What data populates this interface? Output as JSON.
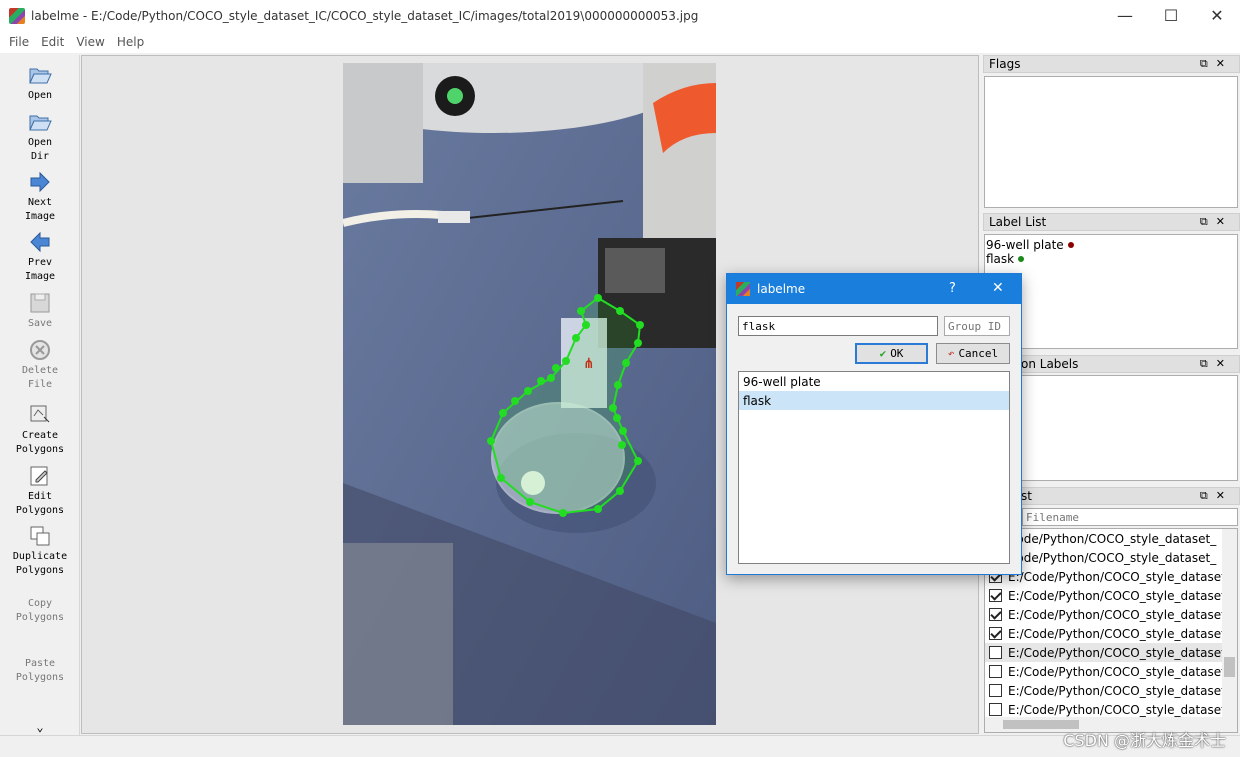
{
  "window": {
    "title": "labelme - E:/Code/Python/COCO_style_dataset_IC/COCO_style_dataset_IC/images/total2019\\000000000053.jpg",
    "controls": [
      "—",
      "☐",
      "✕"
    ]
  },
  "menu": [
    "File",
    "Edit",
    "View",
    "Help"
  ],
  "toolbar": {
    "open": "Open",
    "open_dir_1": "Open",
    "open_dir_2": "Dir",
    "next_1": "Next",
    "next_2": "Image",
    "prev_1": "Prev",
    "prev_2": "Image",
    "save": "Save",
    "delete_1": "Delete",
    "delete_2": "File",
    "create_1": "Create",
    "create_2": "Polygons",
    "edit_1": "Edit",
    "edit_2": "Polygons",
    "duplicate_1": "Duplicate",
    "duplicate_2": "Polygons",
    "copy_1": "Copy",
    "copy_2": "Polygons",
    "paste_1": "Paste",
    "paste_2": "Polygons",
    "more": "⌄"
  },
  "docks": {
    "flags": {
      "title": "Flags"
    },
    "label_list": {
      "title": "Label List",
      "items": [
        {
          "label": "96-well plate",
          "color": "#8b0000"
        },
        {
          "label": "flask",
          "color": "#1b8a1b"
        }
      ]
    },
    "polygon_labels": {
      "title": "on Labels"
    },
    "file_list": {
      "title": "st",
      "search_placeholder": "Filename",
      "rows": [
        {
          "path": "Code/Python/COCO_style_dataset_",
          "checked": true
        },
        {
          "path": "Code/Python/COCO_style_dataset_",
          "checked": true
        },
        {
          "path": "E:/Code/Python/COCO_style_dataset_",
          "checked": true
        },
        {
          "path": "E:/Code/Python/COCO_style_dataset_",
          "checked": true
        },
        {
          "path": "E:/Code/Python/COCO_style_dataset_",
          "checked": true
        },
        {
          "path": "E:/Code/Python/COCO_style_dataset_",
          "checked": true
        },
        {
          "path": "E:/Code/Python/COCO_style_dataset_",
          "checked": false
        },
        {
          "path": "E:/Code/Python/COCO_style_dataset_",
          "checked": false
        },
        {
          "path": "E:/Code/Python/COCO_style_dataset_",
          "checked": false
        },
        {
          "path": "E:/Code/Python/COCO_style_dataset",
          "checked": false
        }
      ]
    }
  },
  "dialog": {
    "title": "labelme",
    "help": "?",
    "close": "✕",
    "label_value": "flask",
    "group_id_placeholder": "Group ID",
    "ok": "OK",
    "cancel": "Cancel",
    "items": [
      "96-well plate",
      "flask"
    ],
    "selected": "flask"
  },
  "watermark": "CSDN @浙大炼金术士",
  "colors": {
    "polygon": "#22dd22",
    "accent": "#1a7fdc"
  }
}
